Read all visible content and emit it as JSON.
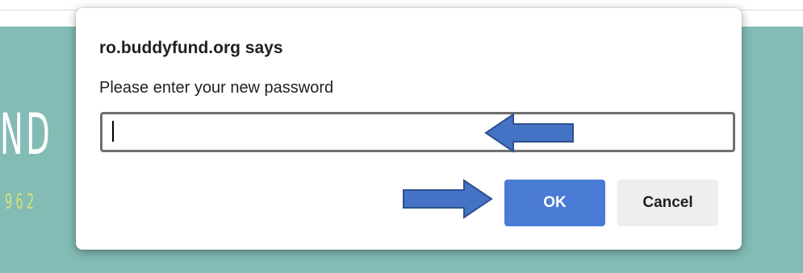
{
  "background": {
    "logo_fragment": "ND",
    "year_fragment": "962",
    "banner_color": "#82bcb5",
    "year_color": "#d7e27a"
  },
  "dialog": {
    "origin": "ro.buddyfund.org says",
    "message": "Please enter your new password",
    "input_value": "",
    "ok_label": "OK",
    "cancel_label": "Cancel",
    "ok_color": "#4a7cd6"
  },
  "annotations": {
    "arrow_color": "#4472c4",
    "arrow_outline": "#2f528f"
  }
}
